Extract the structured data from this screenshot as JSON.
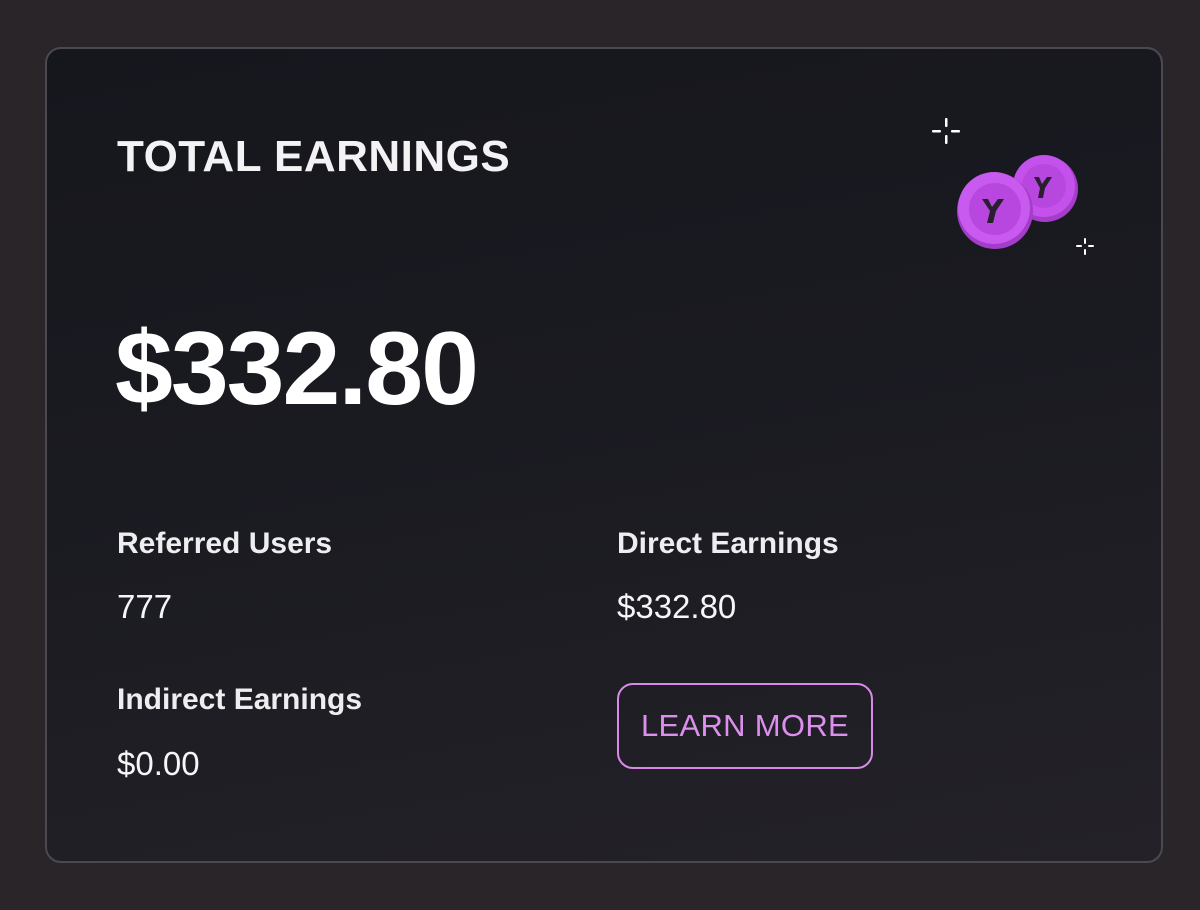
{
  "card": {
    "title": "TOTAL EARNINGS",
    "total_amount": "$332.80"
  },
  "stats": {
    "referred_users": {
      "label": "Referred Users",
      "value": "777"
    },
    "direct_earnings": {
      "label": "Direct Earnings",
      "value": "$332.80"
    },
    "indirect_earnings": {
      "label": "Indirect Earnings",
      "value": "$0.00"
    }
  },
  "actions": {
    "learn_more_label": "LEARN MORE"
  },
  "decoration": {
    "icons": [
      "sparkle-icon",
      "coin-icon",
      "coin-icon",
      "sparkle-icon"
    ]
  },
  "colors": {
    "page_background": "#2a2529",
    "card_background": "#18181e",
    "accent": "#d98ae9",
    "coin": "#c24ee8"
  }
}
